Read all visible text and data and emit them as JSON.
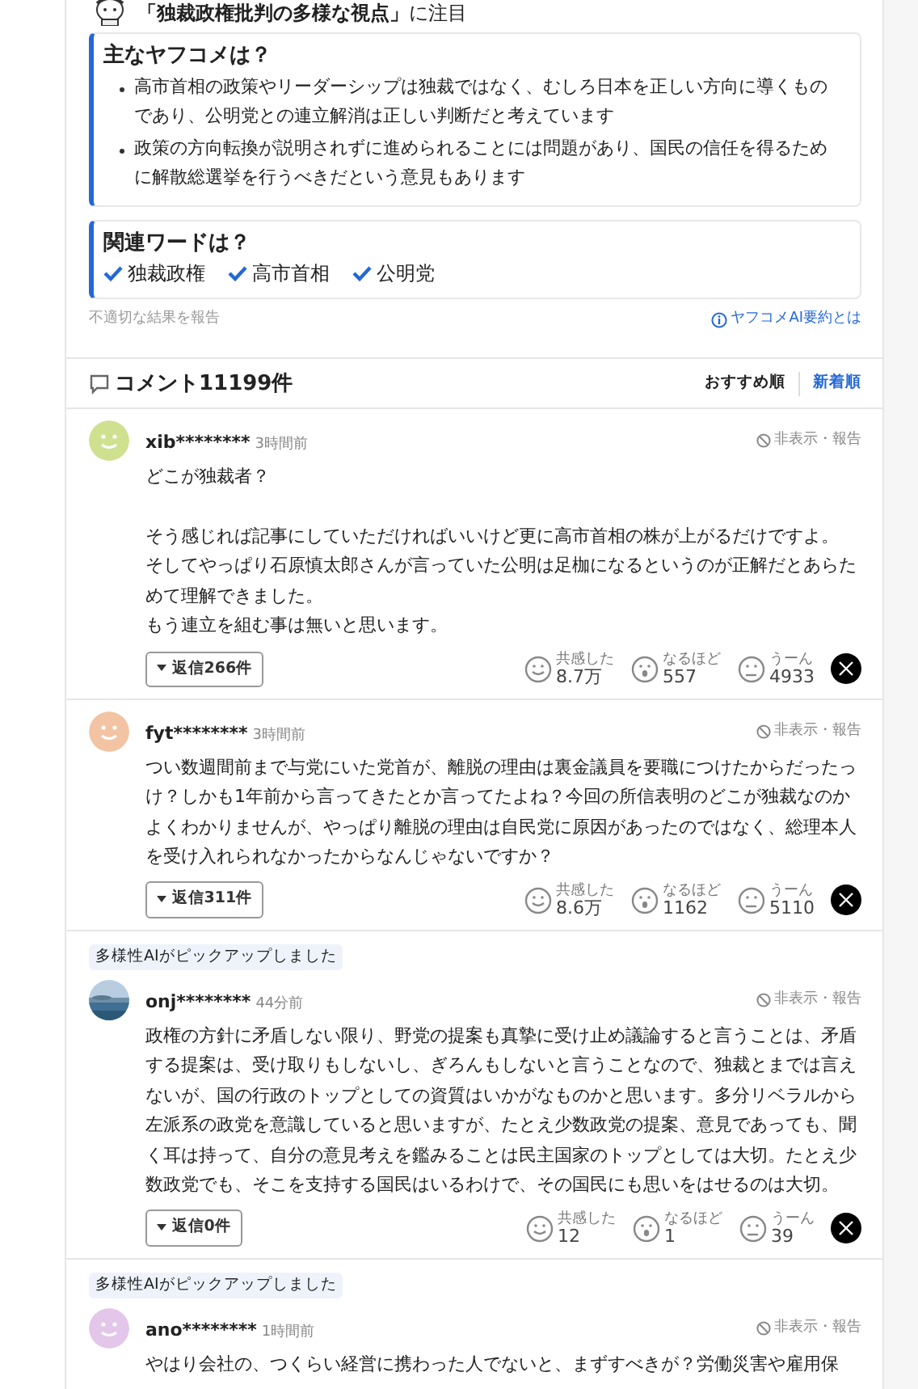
{
  "headline": {
    "text": "**「独裁政権批判の多様な視点」**に注目"
  },
  "summary": {
    "title": "主なヤフコメは？",
    "points": [
      "高市首相の政策やリーダーシップは独裁ではなく、むしろ日本を正しい方向に導くものであり、公明党との連立解消は正しい判断だと考えています",
      "政策の方向転換が説明されずに進められることには問題があり、国民の信任を得るために解散総選挙を行うべきだという意見もあります"
    ]
  },
  "related_words": {
    "title": "関連ワードは？",
    "words": [
      "独裁政権",
      "高市首相",
      "公明党"
    ]
  },
  "report_link": "不適切な結果を報告",
  "about_link": "ヤフコメAI要約とは",
  "comments_header": {
    "title": "コメント11199件",
    "sort_options": [
      {
        "label": "おすすめ順",
        "selected": true
      },
      {
        "label": "新着順",
        "selected": false
      }
    ]
  },
  "comments": [
    {
      "user": "xib********",
      "time": "3時間前",
      "avatar": {
        "kind": "face",
        "color": "#cfe08f"
      },
      "hide_report": "非表示・報告",
      "body": [
        [
          "どこが独裁者？"
        ],
        [
          "そう感じれば記事にしていただければいいけど更に高市首相の株が上がるだけですよ。",
          "そしてやっぱり石原慎太郎さんが言っていた公明は足枷になるというのが正解だとあらためて理解できました。",
          "もう連立を組む事は無いと思います。"
        ]
      ],
      "replies": "返信266件",
      "reactions": [
        {
          "kind": "empathy",
          "label": "共感した",
          "count": "8.7万"
        },
        {
          "kind": "insight",
          "label": "なるほど",
          "count": "557"
        },
        {
          "kind": "doubt",
          "label": "うーん",
          "count": "4933"
        }
      ]
    },
    {
      "user": "fyt********",
      "time": "3時間前",
      "avatar": {
        "kind": "face",
        "color": "#f2c4a4"
      },
      "hide_report": "非表示・報告",
      "body": [
        [
          "つい数週間前まで与党にいた党首が、離脱の理由は裏金議員を要職につけたからだったっけ？しかも1年前から言ってきたとか言ってたよね？今回の所信表明のどこが独裁なのかよくわかりませんが、やっぱり離脱の理由は自民党に原因があったのではなく、総理本人を受け入れられなかったからなんじゃないですか？"
        ]
      ],
      "replies": "返信311件",
      "reactions": [
        {
          "kind": "empathy",
          "label": "共感した",
          "count": "8.6万"
        },
        {
          "kind": "insight",
          "label": "なるほど",
          "count": "1162"
        },
        {
          "kind": "doubt",
          "label": "うーん",
          "count": "5110"
        }
      ]
    },
    {
      "pick_label": "多様性AIがピックアップしました",
      "user": "onj********",
      "time": "44分前",
      "avatar": {
        "kind": "picture"
      },
      "hide_report": "非表示・報告",
      "body": [
        [
          "政権の方針に矛盾しない限り、野党の提案も真摯に受け止め議論すると言うことは、矛盾する提案は、受け取りもしないし、ぎろんもしないと言うことなので、独裁とまでは言えないが、国の行政のトップとしての資質はいかがなものかと思います。多分リベラルから左派系の政党を意識していると思いますが、たとえ少数政党の提案、意見であっても、聞く耳は持って、自分の意見考えを鑑みることは民主国家のトップとしては大切。たとえ少数政党でも、そこを支持する国民はいるわけで、その国民にも思いをはせるのは大切。"
        ]
      ],
      "replies": "返信0件",
      "reactions": [
        {
          "kind": "empathy",
          "label": "共感した",
          "count": "12"
        },
        {
          "kind": "insight",
          "label": "なるほど",
          "count": "1"
        },
        {
          "kind": "doubt",
          "label": "うーん",
          "count": "39"
        }
      ]
    },
    {
      "pick_label": "多様性AIがピックアップしました",
      "user": "ano********",
      "time": "1時間前",
      "avatar": {
        "kind": "face",
        "color": "#e3c6ea"
      },
      "hide_report": "非表示・報告",
      "body": [
        [
          "やはり会社の、つくらい経営に携わった人でないと、まずすべきが？労働災害や雇用保"
        ]
      ]
    }
  ]
}
